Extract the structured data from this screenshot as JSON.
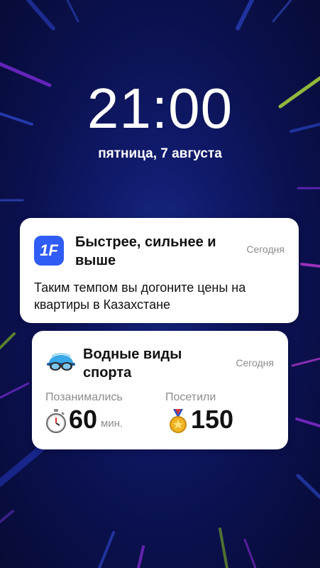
{
  "lockscreen": {
    "time": "21:00",
    "date": "пятница, 7 августа"
  },
  "notifications": [
    {
      "app_icon": "1F",
      "title": "Быстрее, сильнее и выше",
      "time": "Сегодня",
      "body": "Таким темпом вы догоните цены на квартиры в Казахстане"
    },
    {
      "app_icon": "swim-cap-goggles-icon",
      "title": "Водные виды спорта",
      "time": "Сегодня",
      "stats": [
        {
          "label": "Позанимались",
          "icon": "stopwatch-icon",
          "value": "60",
          "unit": "мин."
        },
        {
          "label": "Посетили",
          "icon": "medal-icon",
          "value": "150"
        }
      ]
    }
  ],
  "colors": {
    "background_dark": "#070b35",
    "background_mid": "#101a6a",
    "app_icon_blue": "#2f5cf5",
    "card": "#ffffff",
    "secondary_text": "#8c8c8c"
  }
}
